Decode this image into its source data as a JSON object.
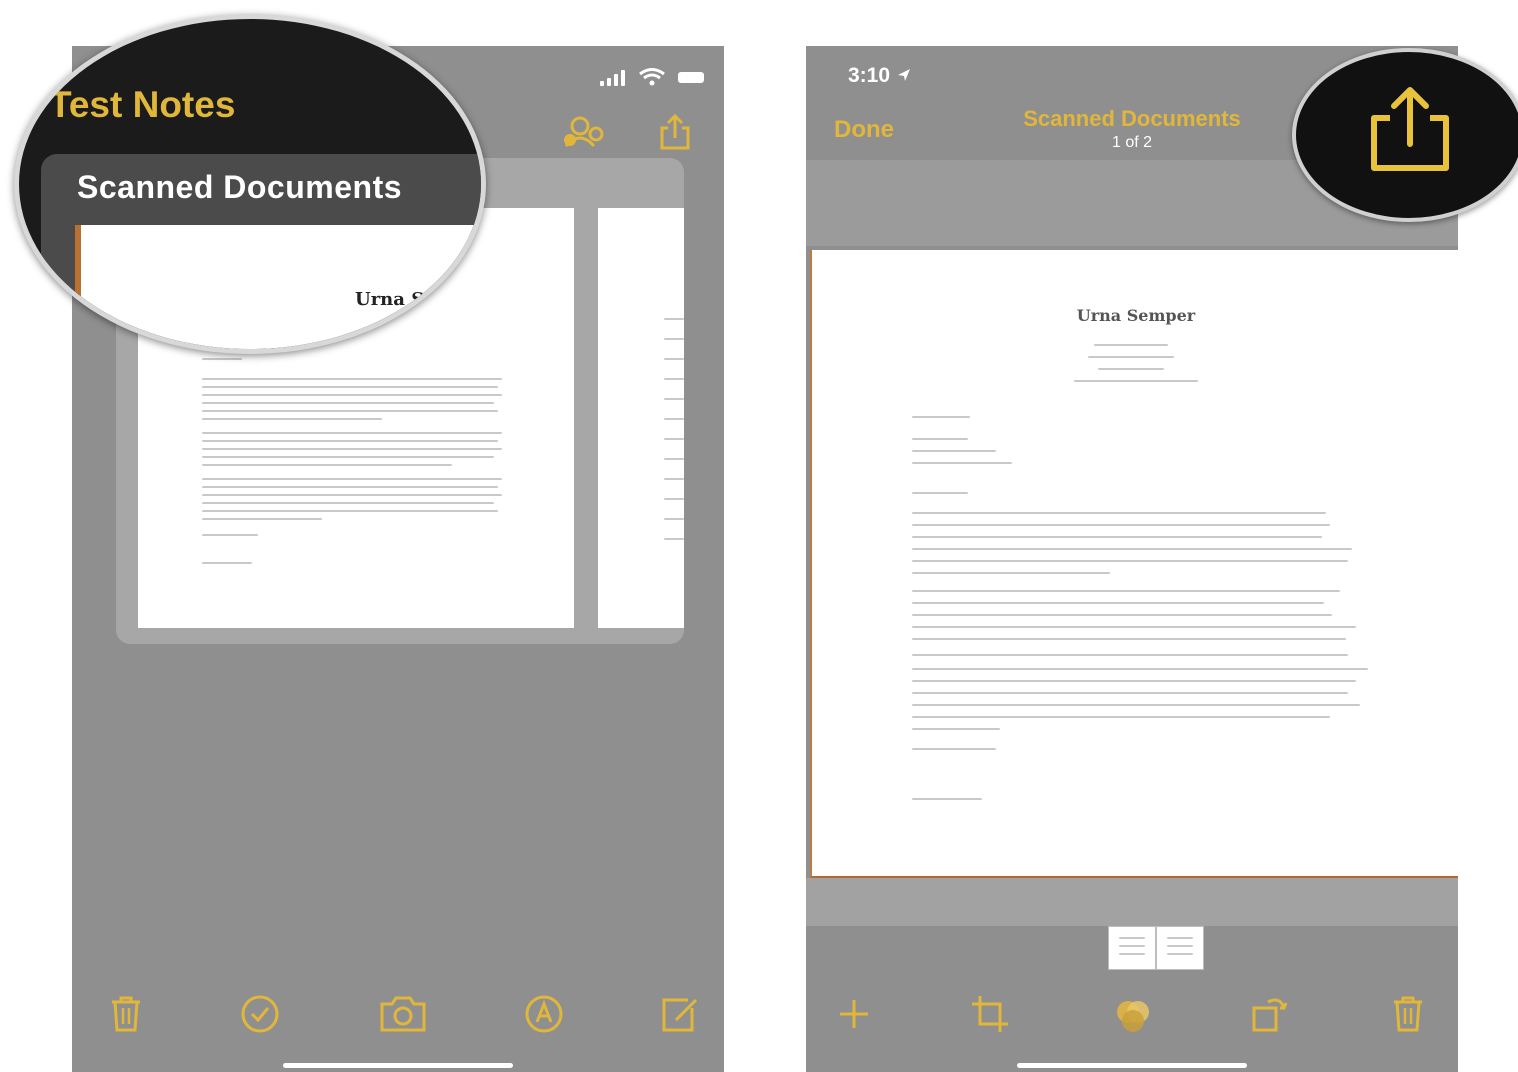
{
  "left_phone": {
    "magnifier": {
      "folder_title": "Test Notes",
      "note_title": "Scanned Documents",
      "letter_name_partial": "Urna S"
    },
    "toolbar_icons": [
      "trash-icon",
      "checkmark-icon",
      "camera-icon",
      "markup-icon",
      "compose-icon"
    ]
  },
  "right_phone": {
    "status_time": "3:10",
    "nav": {
      "done_label": "Done",
      "title": "Scanned Documents",
      "page_count": "1 of 2"
    },
    "letter": {
      "sender_name": "Urna Semper"
    },
    "toolbar_icons": [
      "add-icon",
      "crop-icon",
      "filters-icon",
      "rotate-icon",
      "trash-icon"
    ]
  },
  "colors": {
    "accent": "#e0b73a",
    "screen_gray": "#8f8f8f",
    "page_white": "#ffffff"
  }
}
